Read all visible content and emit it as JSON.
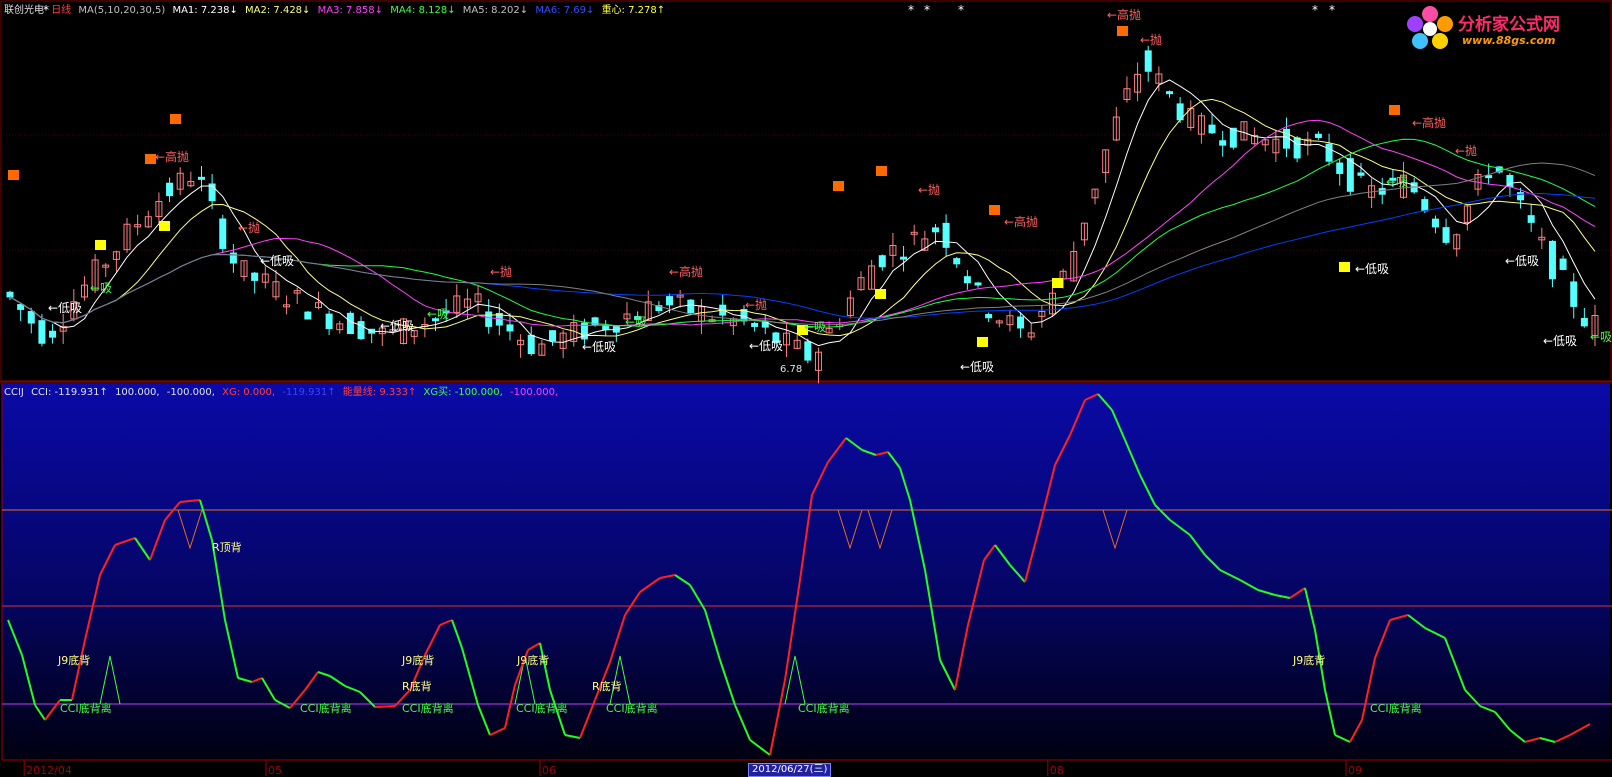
{
  "header": {
    "stock_name": "联创光电",
    "period": "日线",
    "ma_label": "MA(5,10,20,30,5)",
    "ma1": "MA1: 7.238↓",
    "ma2": "MA2: 7.428↓",
    "ma3": "MA3: 7.858↓",
    "ma4": "MA4: 8.128↓",
    "ma5": "MA5: 8.202↓",
    "ma6": "MA6: 7.69↓",
    "center": "重心: 7.278↑"
  },
  "indicator_header": {
    "name": "CCIJ",
    "cci": "CCI: -119.931↑",
    "l1": "100.000,",
    "l2": "-100.000,",
    "xg": "XG: 0.000,",
    "xg_val": "-119.931↑",
    "energy": "能量线: 9.333↑",
    "xg_buy": "XG买: -100.000,",
    "xg_buy2": "-100.000,"
  },
  "logo": {
    "title": "分析家公式网",
    "url": "www.88gs.com"
  },
  "price_labels": {
    "low_price": "6.78"
  },
  "axis": {
    "dates": [
      {
        "label": "2012/04",
        "pos": 0.015
      },
      {
        "label": "05",
        "pos": 0.165
      },
      {
        "label": "06",
        "pos": 0.335
      },
      {
        "label": "08",
        "pos": 0.65
      },
      {
        "label": "09",
        "pos": 0.835
      }
    ],
    "cursor_date": "2012/06/27(三)"
  },
  "signal_labels": {
    "di_xi": "←低吸",
    "xi": "←吸",
    "pao": "←抛",
    "gao_pao": "←高抛",
    "j9": "J9底背",
    "r_di": "R底背",
    "r_ding": "R顶背",
    "cci_div": "CCI底背离"
  },
  "colors": {
    "up": "#ff8080",
    "down": "#54ffff",
    "cci_up": "#ff2020",
    "cci_down": "#20ff20",
    "ma1": "#ffffff",
    "ma2": "#ffff80",
    "ma3": "#ff40ff",
    "ma4": "#20ff40",
    "ma5": "#0040ff",
    "ma6": "#808080"
  },
  "cci_levels": {
    "upper": 100,
    "lower": -100,
    "mid": 0
  }
}
